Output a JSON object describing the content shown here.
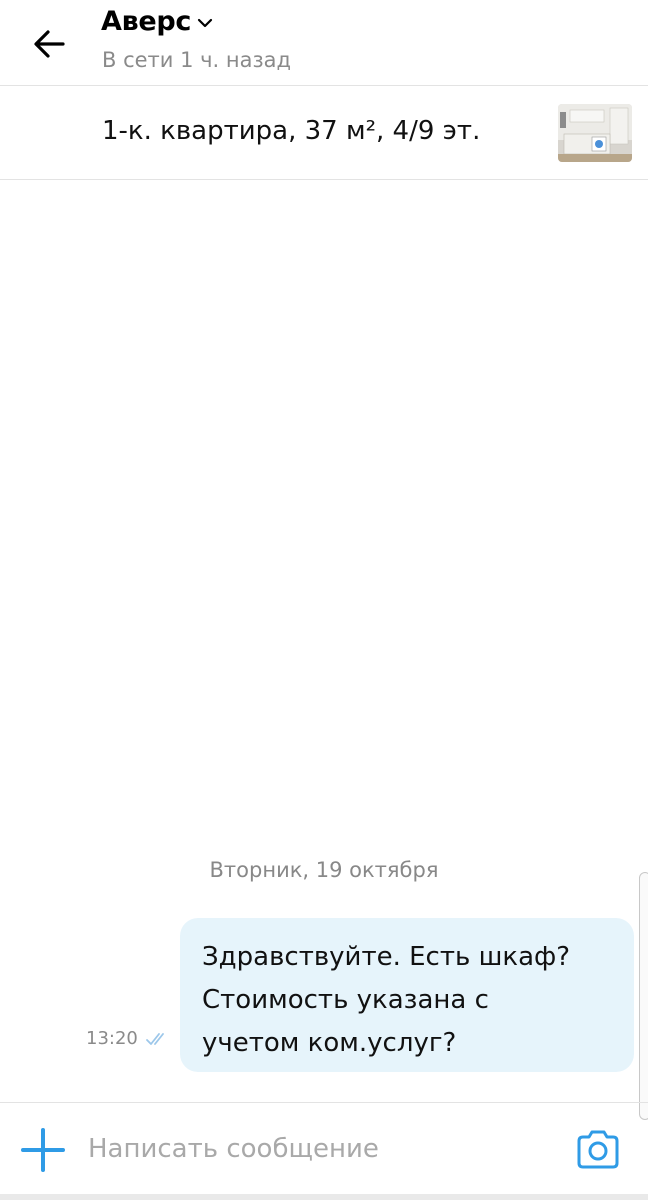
{
  "header": {
    "title": "Аверс",
    "status": "В сети 1 ч. назад"
  },
  "listing": {
    "title": "1-к. квартира, 37 м², 4/9 эт.",
    "thumbnail_icon": "apartment-photo"
  },
  "chat": {
    "date_separator": "Вторник, 19 октября",
    "messages": [
      {
        "direction": "outgoing",
        "lines": [
          "Здравствуйте. Есть шкаф?",
          "Стоимость указана с",
          "учетом ком.услуг?"
        ],
        "time": "13:20",
        "status_icon": "read-double-check-icon"
      }
    ]
  },
  "composer": {
    "placeholder": "Написать сообщение",
    "value": "",
    "attach_icon": "plus-icon",
    "camera_icon": "camera-icon"
  },
  "colors": {
    "accent": "#2f9be6",
    "bubble_outgoing": "#e6f4fb",
    "secondary_text": "#8a8a8a",
    "divider": "#e3e3e3"
  }
}
